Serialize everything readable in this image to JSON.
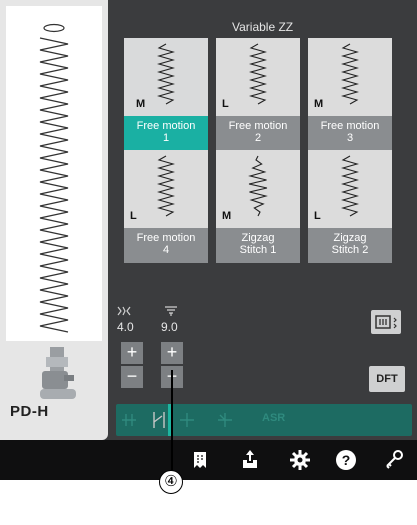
{
  "category_title": "Variable ZZ",
  "presser_foot": "PD-H",
  "patterns": [
    {
      "size": "M",
      "name_line1": "Free motion",
      "name_line2": "1",
      "selected": true
    },
    {
      "size": "L",
      "name_line1": "Free motion",
      "name_line2": "2",
      "selected": false
    },
    {
      "size": "M",
      "name_line1": "Free motion",
      "name_line2": "3",
      "selected": false
    },
    {
      "size": "L",
      "name_line1": "Free motion",
      "name_line2": "4",
      "selected": false
    },
    {
      "size": "M",
      "name_line1": "Zigzag",
      "name_line2": "Stitch 1",
      "selected": false
    },
    {
      "size": "L",
      "name_line1": "Zigzag",
      "name_line2": "Stitch 2",
      "selected": false
    }
  ],
  "width": {
    "value": "4.0",
    "icon": "stitch-width-icon"
  },
  "length": {
    "value": "9.0",
    "icon": "stitch-length-icon"
  },
  "buttons": {
    "plus": "+",
    "minus": "−",
    "dft": "DFT"
  },
  "strip": {
    "asr": "ASR"
  },
  "toolbar_icons": [
    "bookmark-icon",
    "upload-icon",
    "gear-icon",
    "help-icon",
    "key-icon"
  ],
  "callout": "④",
  "colors": {
    "accent": "#1ab0a3",
    "panel": "#3b3c3e",
    "toolbar": "#0f0f10",
    "strip": "#1d6b62"
  }
}
